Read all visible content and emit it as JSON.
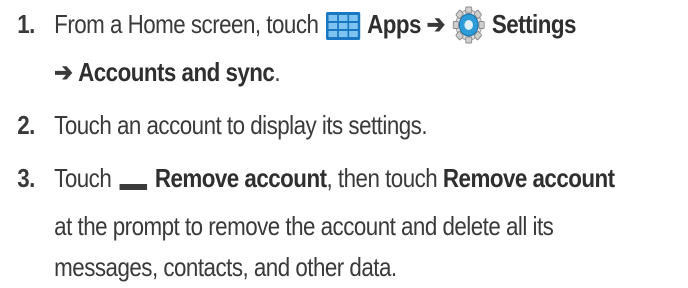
{
  "steps": [
    {
      "number": "1.",
      "line1_pre": "From a Home screen, touch",
      "apps_label": "Apps",
      "arrow": "➔",
      "settings_label": "Settings",
      "line2_arrow": "➔",
      "accounts_label": "Accounts and sync",
      "line2_end": ".",
      "icons": [
        "apps-grid-icon",
        "settings-gear-icon"
      ]
    },
    {
      "number": "2.",
      "text": "Touch an account to display its settings."
    },
    {
      "number": "3.",
      "pre": "Touch",
      "remove_label_1": "Remove account",
      "mid": ", then touch",
      "remove_label_2": "Remove account",
      "line2": "at the prompt to remove the account and delete all its",
      "line3": "messages, contacts, and other data.",
      "icons": [
        "remove-minus-icon"
      ]
    }
  ],
  "colors": {
    "text": "#3a3a3a",
    "apps_icon": "#1a78c2",
    "gear_icon": "#2d9bd8",
    "remove_icon": "#3b3b3b"
  }
}
